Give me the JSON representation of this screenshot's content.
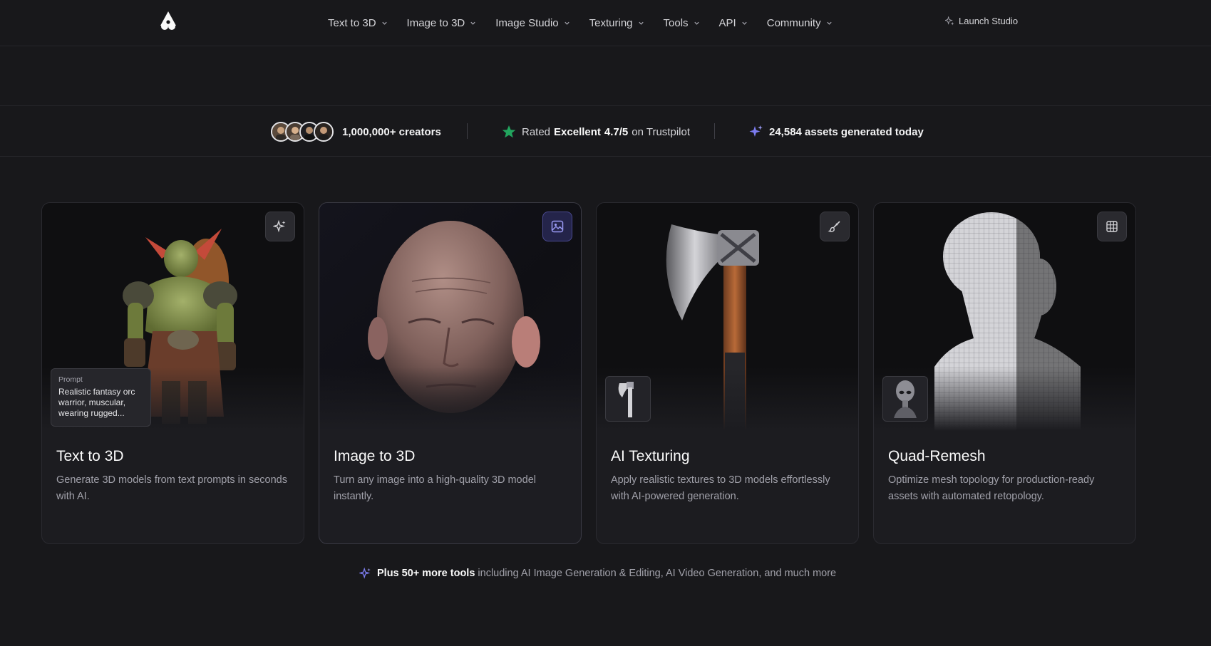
{
  "header": {
    "logo_icon": "brand-logo-icon",
    "nav": [
      {
        "label": "Text to 3D"
      },
      {
        "label": "Image to 3D"
      },
      {
        "label": "Image Studio"
      },
      {
        "label": "Texturing"
      },
      {
        "label": "Tools"
      },
      {
        "label": "API"
      },
      {
        "label": "Community"
      }
    ],
    "launch_label": "Launch Studio"
  },
  "stats": {
    "creators": "1,000,000+ creators",
    "rating_prefix": "Rated",
    "rating_word": "Excellent",
    "rating_score": "4.7/5",
    "rating_suffix": "on Trustpilot",
    "assets": "24,584 assets generated today"
  },
  "cards": [
    {
      "title": "Text to 3D",
      "desc": "Generate 3D models from text prompts in seconds with AI.",
      "icon": "sparkles-icon",
      "prompt_label": "Prompt",
      "prompt_text": "Realistic fantasy orc warrior, muscular, wearing rugged..."
    },
    {
      "title": "Image to 3D",
      "desc": "Turn any image into a high-quality 3D model instantly.",
      "icon": "image-icon"
    },
    {
      "title": "AI Texturing",
      "desc": "Apply realistic textures to 3D models effortlessly with AI-powered generation.",
      "icon": "paintbrush-icon"
    },
    {
      "title": "Quad-Remesh",
      "desc": "Optimize mesh topology for production-ready assets with automated retopology.",
      "icon": "grid-icon"
    }
  ],
  "more": {
    "bold": "Plus 50+ more tools",
    "rest": "including AI Image Generation & Editing, AI Video Generation, and much more"
  },
  "colors": {
    "background": "#18181b",
    "accent": "#7c7cf0",
    "trustpilot_green": "#22a55e"
  }
}
